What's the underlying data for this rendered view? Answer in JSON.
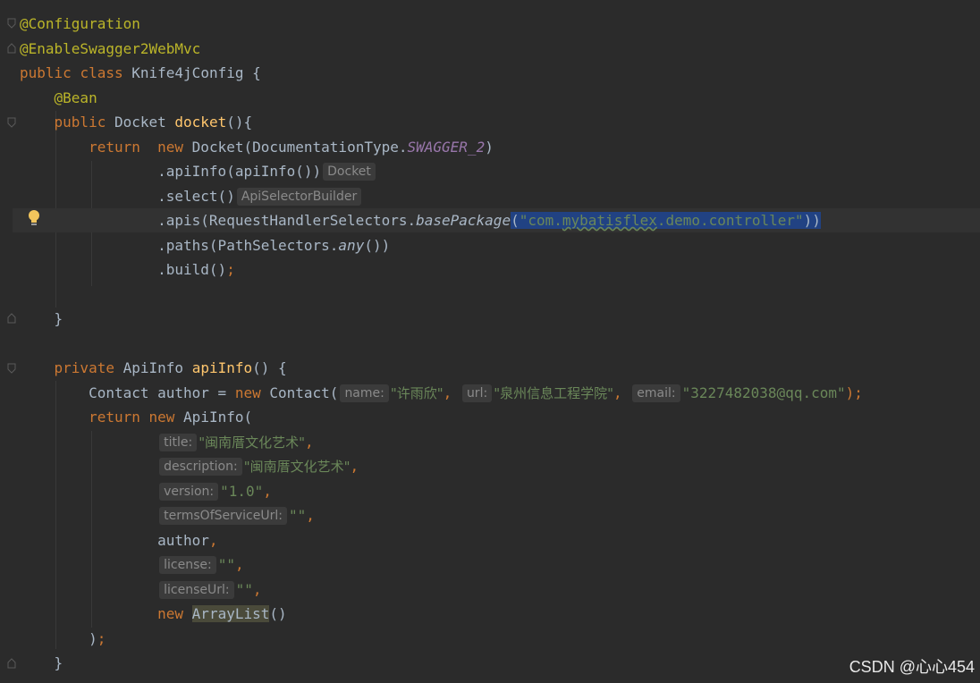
{
  "code": {
    "ann_configuration": "@Configuration",
    "ann_swagger": "@EnableSwagger2WebMvc",
    "kw_public": "public",
    "kw_class": "class",
    "class_name": "Knife4jConfig",
    "brace_open": "{",
    "ann_bean": "@Bean",
    "docket_type": "Docket",
    "docket_method": "docket",
    "parens_brace": "(){",
    "kw_return": "return",
    "kw_new": "new",
    "docket_ctor": "Docket(DocumentationType.",
    "swagger_const": "SWAGGER_2",
    "close_paren": ")",
    "apiinfo_call": ".apiInfo(apiInfo())",
    "hint_docket": "Docket",
    "select_call": ".select()",
    "hint_selector": "ApiSelectorBuilder",
    "apis_call": ".apis(RequestHandlerSelectors.",
    "base_package": "basePackage",
    "paren_open": "(",
    "pkg_quote_open": "\"com.",
    "pkg_mybatis": "mybatisflex",
    "pkg_rest": ".demo.controller\"",
    "double_close": "))",
    "paths_call": ".paths(PathSelectors.",
    "any_method": "any",
    "paths_end": "())",
    "build_call": ".build()",
    "semicolon": ";",
    "brace_close": "}",
    "kw_private": "private",
    "apiinfo_type": "ApiInfo",
    "apiinfo_method": "apiInfo",
    "method_parens": "() {",
    "contact_decl": "Contact author = ",
    "contact_ctor": "Contact(",
    "hint_name": "name:",
    "val_name": "\"许雨欣\"",
    "comma_sp": ", ",
    "hint_url": "url:",
    "val_url": "\"泉州信息工程学院\"",
    "hint_email": "email:",
    "val_email": "\"3227482038@qq.com\"",
    "close_semi": ");",
    "apiinfo_ctor": "ApiInfo(",
    "hint_title": "title:",
    "val_title": "\"闽南厝文化艺术\"",
    "comma": ",",
    "hint_description": "description:",
    "val_description": "\"闽南厝文化艺术\"",
    "hint_version": "version:",
    "val_version": "\"1.0\"",
    "hint_terms": "termsOfServiceUrl:",
    "val_empty": "\"\"",
    "author_ref": "author",
    "hint_license": "license:",
    "hint_license_url": "licenseUrl:",
    "arraylist": "ArrayList",
    "parens": "()",
    "paren_close_only": ")"
  },
  "watermark": "CSDN @心心454",
  "colors": {
    "background": "#2b2b2b",
    "keyword": "#cc7832",
    "annotation": "#bbb529",
    "method": "#ffc66d",
    "string": "#6a8759",
    "constant": "#9876aa",
    "selection": "#214283"
  }
}
